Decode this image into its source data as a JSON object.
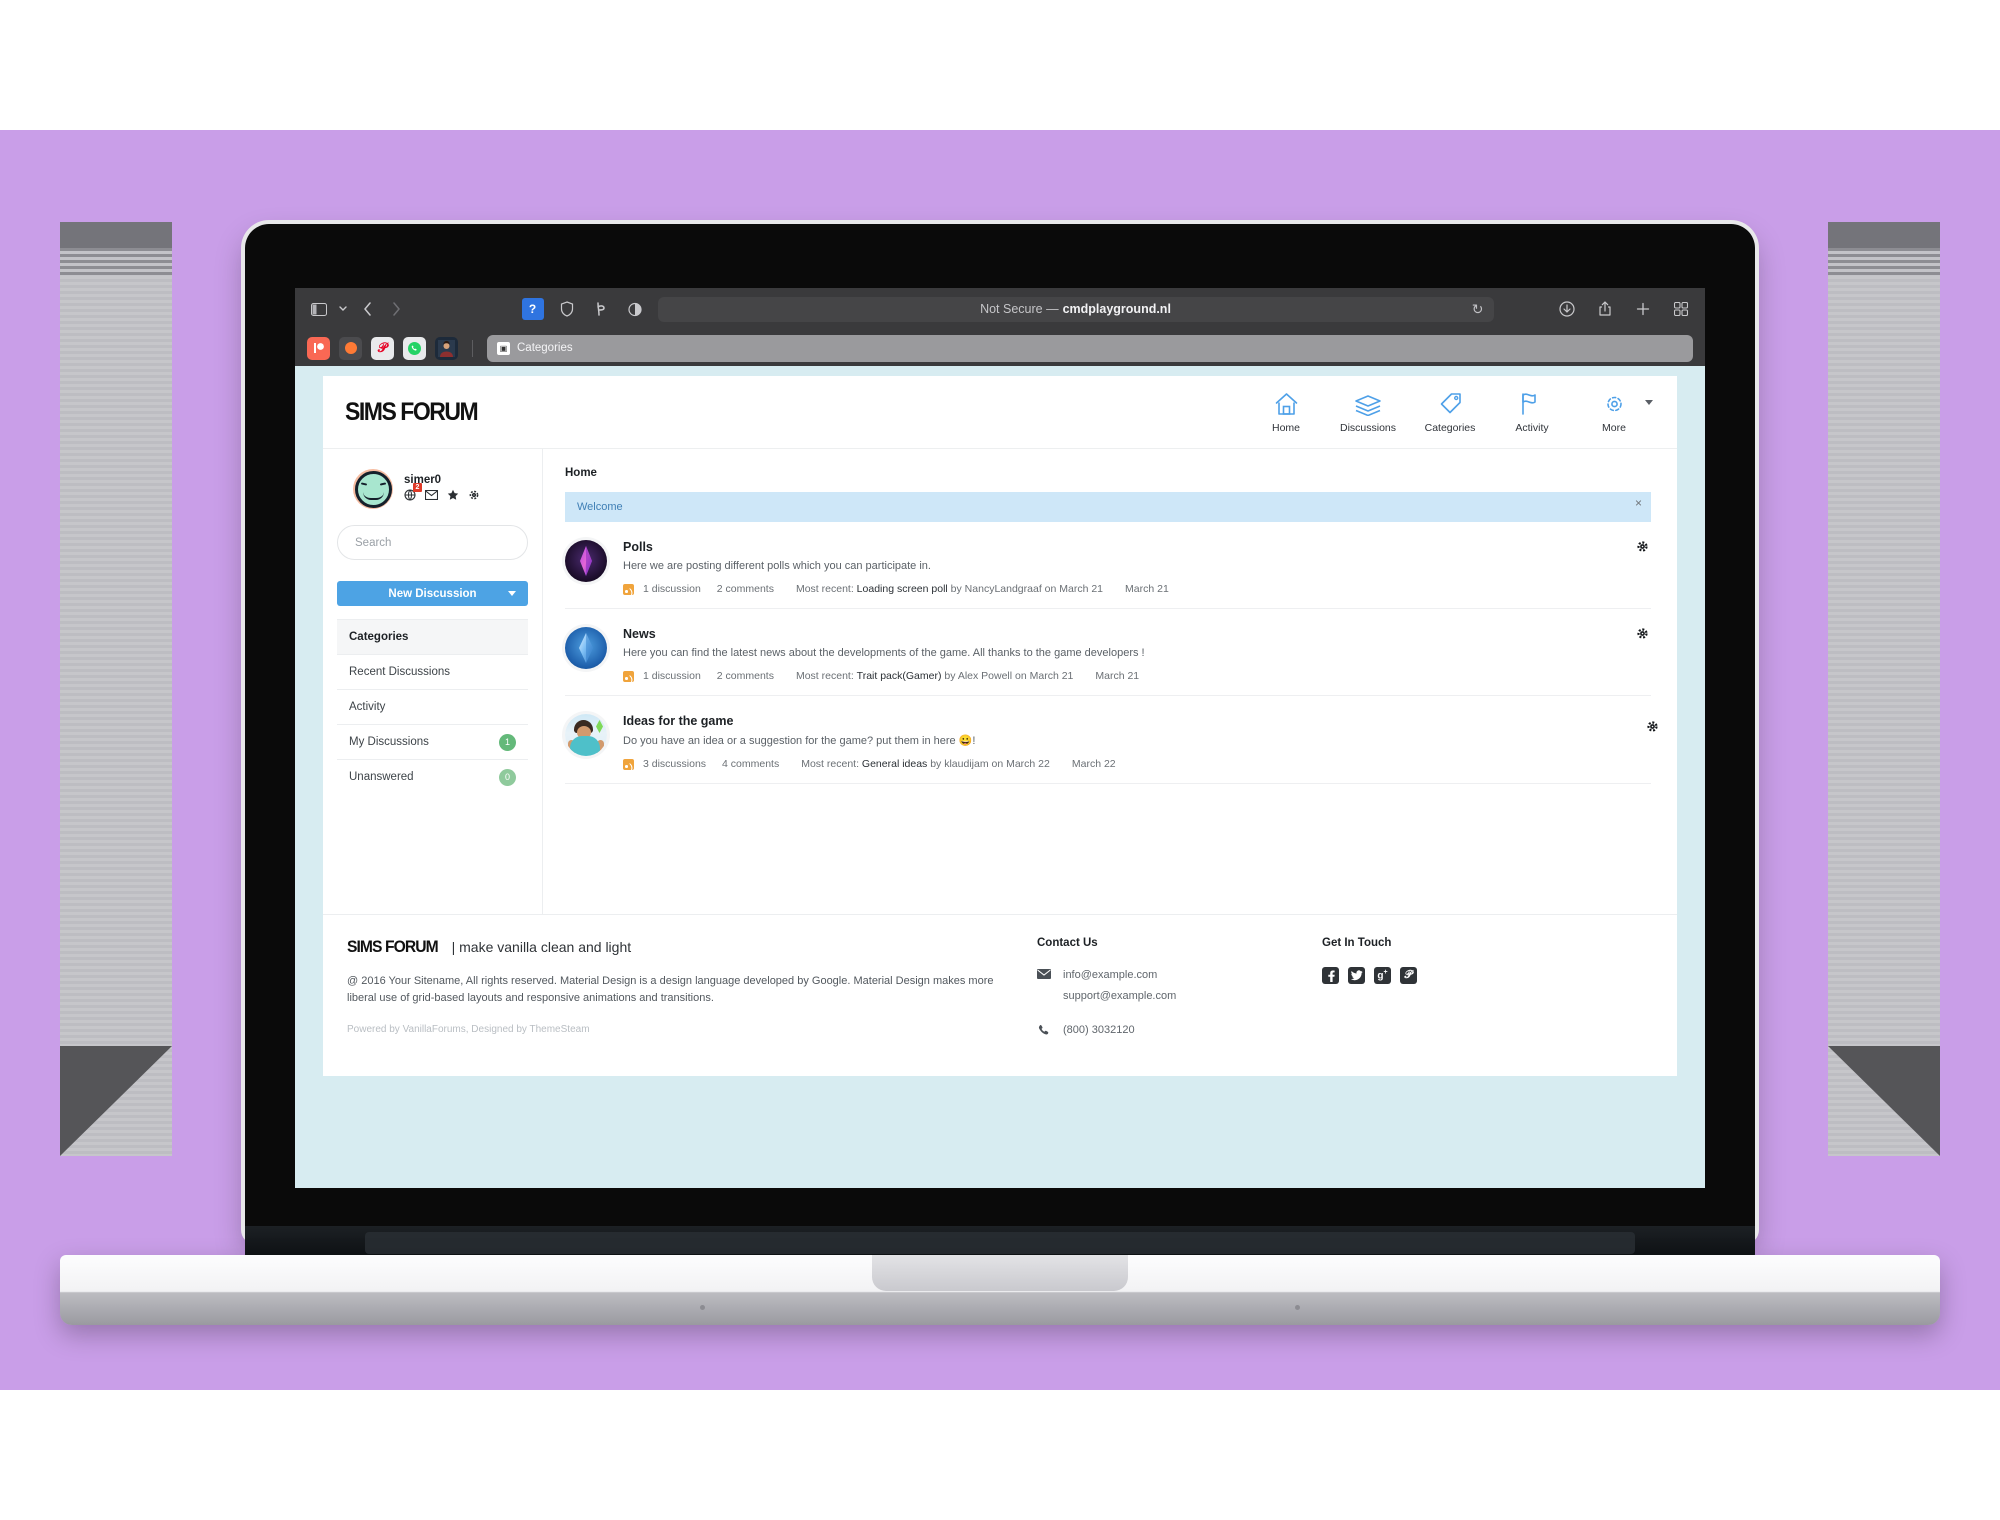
{
  "browser": {
    "url_prefix": "Not Secure —",
    "url_domain": "cmdplayground.nl",
    "reload_icon": "reload-icon",
    "sidebar_icon": "sidebar-toggle-icon",
    "back_icon": "back-arrow-icon",
    "forward_icon": "forward-arrow-icon",
    "extensions": [
      "question-badge-extension",
      "shield-extension",
      "honey-extension",
      "contrast-extension"
    ],
    "right_icons": [
      "downloads-icon",
      "share-icon",
      "new-tab-icon",
      "tab-overview-icon"
    ],
    "favorites": [
      "patreon-favicon",
      "coil-favicon",
      "pinterest-favicon",
      "whatsapp-favicon",
      "profile-favicon"
    ],
    "tab": {
      "label": "Categories",
      "favicon": "page-favicon"
    }
  },
  "site": {
    "brand": "SIMS FORUM",
    "nav": [
      {
        "label": "Home",
        "icon": "home-icon"
      },
      {
        "label": "Discussions",
        "icon": "layers-icon"
      },
      {
        "label": "Categories",
        "icon": "tag-icon"
      },
      {
        "label": "Activity",
        "icon": "flag-icon"
      },
      {
        "label": "More",
        "icon": "gear-icon"
      }
    ]
  },
  "sidebar": {
    "user": {
      "name": "simer0",
      "avatar": "smiley-avatar",
      "icons": [
        "globe-icon",
        "envelope-icon",
        "star-icon",
        "gear-icon"
      ],
      "notification_count": "2"
    },
    "search": {
      "placeholder": "Search",
      "value": ""
    },
    "new_discussion": {
      "label": "New Discussion",
      "caret": "chevron-down-icon"
    },
    "items": [
      {
        "label": "Categories",
        "count": null,
        "active": true
      },
      {
        "label": "Recent Discussions",
        "count": null,
        "active": false
      },
      {
        "label": "Activity",
        "count": null,
        "active": false
      },
      {
        "label": "My Discussions",
        "count": "1",
        "active": false
      },
      {
        "label": "Unanswered",
        "count": "0",
        "active": false
      }
    ]
  },
  "main": {
    "breadcrumb": "Home",
    "welcome": {
      "text": "Welcome",
      "close": "×"
    },
    "categories": [
      {
        "title": "Polls",
        "description": "Here we are posting different polls which you can participate in.",
        "discussions": "1 discussion",
        "comments": "2 comments",
        "recent_prefix": "Most recent:",
        "recent_title": "Loading screen poll",
        "recent_by": "by NancyLandgraaf on March 21",
        "date": "March 21",
        "icon": "plumbob-purple-icon",
        "gear": "gear-icon"
      },
      {
        "title": "News",
        "description": "Here you can find the latest news about the developments of the game. All thanks to the game developers !",
        "discussions": "1 discussion",
        "comments": "2 comments",
        "recent_prefix": "Most recent:",
        "recent_title": "Trait pack(Gamer)",
        "recent_by": "by Alex Powell on March 21",
        "date": "March 21",
        "icon": "plumbob-blue-icon",
        "gear": "gear-icon"
      },
      {
        "title": "Ideas for the game",
        "description": "Do you have an idea or a suggestion for the game? put them in here 😀!",
        "discussions": "3 discussions",
        "comments": "4 comments",
        "recent_prefix": "Most recent:",
        "recent_title": "General ideas",
        "recent_by": "by klaudijam on March 22",
        "date": "March 22",
        "icon": "sim-character-icon",
        "gear": "gear-icon"
      }
    ]
  },
  "footer": {
    "brand": "SIMS FORUM",
    "tagline": "| make vanilla clean and light",
    "copyright": "@ 2016 Your Sitename, All rights reserved. Material Design is a design language developed by Google. Material Design makes more liberal use of grid-based layouts and responsive animations and transitions.",
    "powered": "Powered by VanillaForums, Designed by ThemeSteam",
    "contact": {
      "heading": "Contact Us",
      "email_icon": "envelope-icon",
      "emails": [
        "info@example.com",
        "support@example.com"
      ],
      "phone_icon": "phone-icon",
      "phone": "(800) 3032120"
    },
    "social": {
      "heading": "Get In Touch",
      "links": [
        {
          "name": "facebook-icon",
          "glyph": "f"
        },
        {
          "name": "twitter-icon",
          "glyph": "t"
        },
        {
          "name": "google-plus-icon",
          "glyph": "g"
        },
        {
          "name": "pinterest-icon",
          "glyph": "p"
        }
      ]
    }
  },
  "colors": {
    "backdrop": "#c99ee8",
    "accent": "#4da3e4",
    "welcome_bg": "#cee7f8",
    "screen_bg": "#d7ecf1",
    "badge_green": "#64b97a"
  }
}
